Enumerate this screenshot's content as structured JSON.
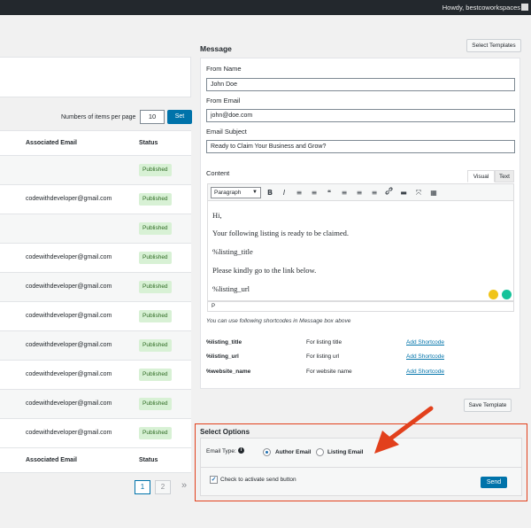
{
  "adminbar": {
    "greeting": "Howdy, bestcoworkspaces"
  },
  "listing": {
    "per_page_label": "Numbers of items per page",
    "per_page_value": "10",
    "set_label": "Set",
    "columns": {
      "email": "Associated Email",
      "status": "Status"
    },
    "rows": [
      {
        "email": "",
        "status": "Published"
      },
      {
        "email": "codewithdeveloper@gmail.com",
        "status": "Published"
      },
      {
        "email": "",
        "status": "Published"
      },
      {
        "email": "codewithdeveloper@gmail.com",
        "status": "Published"
      },
      {
        "email": "codewithdeveloper@gmail.com",
        "status": "Published"
      },
      {
        "email": "codewithdeveloper@gmail.com",
        "status": "Published"
      },
      {
        "email": "codewithdeveloper@gmail.com",
        "status": "Published"
      },
      {
        "email": "codewithdeveloper@gmail.com",
        "status": "Published"
      },
      {
        "email": "codewithdeveloper@gmail.com",
        "status": "Published"
      },
      {
        "email": "codewithdeveloper@gmail.com",
        "status": "Published"
      }
    ],
    "pagination": {
      "page1": "1",
      "page2": "2",
      "next": "»"
    }
  },
  "message": {
    "title": "Message",
    "select_templates": "Select Templates",
    "from_name_label": "From Name",
    "from_name_value": "John Doe",
    "from_email_label": "From Email",
    "from_email_value": "john@doe.com",
    "subject_label": "Email Subject",
    "subject_value": "Ready to Claim Your Business and Grow?",
    "content_label": "Content",
    "tab_visual": "Visual",
    "tab_text": "Text",
    "format_select": "Paragraph",
    "toolbar": [
      "B",
      "I",
      "≡",
      "≡",
      "❝",
      "≡",
      "≡",
      "≡",
      "🔗",
      "▬",
      "⤧",
      "▦"
    ],
    "body_lines": [
      "Hi,",
      "Your following listing is ready to be claimed.",
      "%listing_title",
      "Please kindly go to the link below.",
      "%listing_url"
    ],
    "path": "P",
    "shortcode_hint": "You can use following shortcodes in Message box above",
    "shortcodes": [
      {
        "code": "%listing_title",
        "desc": "For listing title",
        "action": "Add Shortcode"
      },
      {
        "code": "%listing_url",
        "desc": "For listing url",
        "action": "Add Shortcode"
      },
      {
        "code": "%website_name",
        "desc": "For website name",
        "action": "Add Shortcode"
      }
    ],
    "save_template": "Save Template"
  },
  "options": {
    "title": "Select Options",
    "email_type_label": "Email Type:",
    "info_icon": "i",
    "author_email": "Author Email",
    "listing_email": "Listing Email",
    "selected": "Author Email",
    "checkbox_label": "Check to activate send button",
    "checkbox_checked": true,
    "send_label": "Send"
  },
  "colors": {
    "accent": "#0073aa",
    "highlight": "#e2401c",
    "published_bg": "#d8f1d5"
  }
}
